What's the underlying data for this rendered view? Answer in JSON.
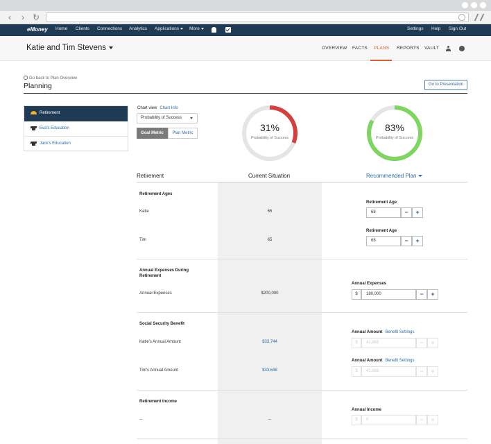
{
  "app_nav": {
    "logo": "eMoney",
    "links": [
      "Home",
      "Clients",
      "Connections",
      "Analytics",
      "Applications",
      "More"
    ],
    "right_links": [
      "Settings",
      "Help",
      "Sign Out"
    ]
  },
  "client": {
    "name": "Katie and Tim Stevens",
    "tabs": [
      "OVERVIEW",
      "FACTS",
      "PLANS",
      "REPORTS",
      "VAULT"
    ],
    "active_tab": "PLANS"
  },
  "page": {
    "back_link": "Go back to Plan Overview",
    "title": "Planning",
    "present_button": "Go to Presentation"
  },
  "sidebar": {
    "items": [
      {
        "label": "Retirement",
        "icon": "sun-icon"
      },
      {
        "label": "Eva's Education",
        "icon": "graduation-cap-icon"
      },
      {
        "label": "Jack's Education",
        "icon": "graduation-cap-icon"
      }
    ]
  },
  "chart_view": {
    "label": "Chart view",
    "info_link": "Chart Info",
    "selected": "Probability of Success",
    "seg_on": "Goal Metric",
    "seg_off": "Plan Metric"
  },
  "gauges": {
    "current": {
      "value": 31,
      "text": "31%",
      "label": "Probability of Success",
      "color": "#d2403f"
    },
    "recommended": {
      "value": 83,
      "text": "83%",
      "label": "Probability of Success",
      "color": "#7ed55f"
    }
  },
  "table": {
    "col_left": "Retirement",
    "col_current": "Current Situation",
    "col_recommended": "Recommended Plan",
    "sections": {
      "ages": {
        "title": "Retirement Ages",
        "rows": [
          {
            "label": "Katie",
            "current": "65",
            "field_label": "Retirement Age",
            "value": "68"
          },
          {
            "label": "Tim",
            "current": "65",
            "field_label": "Retirement Age",
            "value": "68"
          }
        ]
      },
      "expenses": {
        "title": "Annual Expenses During Retirement",
        "row_label": "Annual Expenses",
        "current": "$200,000",
        "field_label": "Annual Expenses",
        "prefix": "$",
        "value": "180,000"
      },
      "social": {
        "title": "Social Security Benefit",
        "rows": [
          {
            "label": "Katie's Annual Amount",
            "current": "$33,744",
            "field_label": "Annual Amount",
            "link": "Benefit Settings",
            "prefix": "$",
            "value": "41,868"
          },
          {
            "label": "Tim's Annual Amount",
            "current": "$33,648",
            "field_label": "Annual Amount",
            "link": "Benefit Settings",
            "prefix": "$",
            "value": "41,868"
          }
        ]
      },
      "income": {
        "title": "Retirement Income",
        "row_label": "--",
        "current": "--",
        "field_label": "Annual Income",
        "prefix": "$",
        "value": "0"
      }
    },
    "stepper_minus": "−",
    "stepper_plus": "+"
  }
}
